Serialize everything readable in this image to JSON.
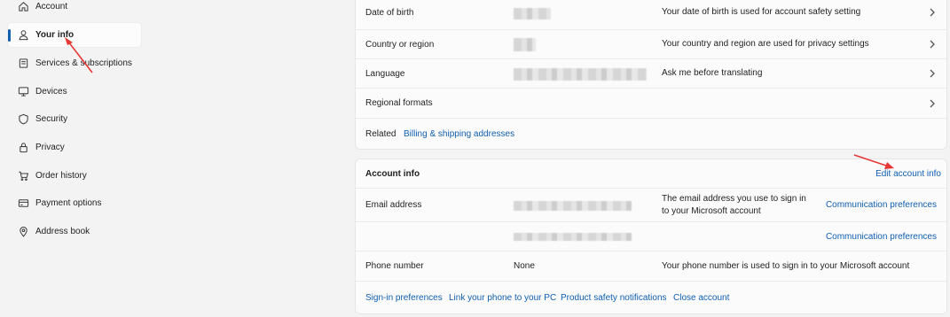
{
  "sidebar": {
    "items": [
      {
        "label": "Account",
        "icon": "home-icon"
      },
      {
        "label": "Your info",
        "icon": "person-icon"
      },
      {
        "label": "Services & subscriptions",
        "icon": "list-icon"
      },
      {
        "label": "Devices",
        "icon": "monitor-icon"
      },
      {
        "label": "Security",
        "icon": "shield-icon"
      },
      {
        "label": "Privacy",
        "icon": "lock-icon"
      },
      {
        "label": "Order history",
        "icon": "cart-icon"
      },
      {
        "label": "Payment options",
        "icon": "card-icon"
      },
      {
        "label": "Address book",
        "icon": "location-icon"
      }
    ],
    "active_index": 1
  },
  "profile_card": {
    "rows": [
      {
        "label": "Date of birth",
        "desc": "Your date of birth is used for account safety setting"
      },
      {
        "label": "Country or region",
        "desc": "Your country and region are used for privacy settings"
      },
      {
        "label": "Language",
        "desc": "Ask me before translating"
      },
      {
        "label": "Regional formats",
        "desc": ""
      }
    ],
    "related_label": "Related",
    "related_link": "Billing & shipping addresses"
  },
  "account_card": {
    "title": "Account info",
    "edit_link": "Edit account info",
    "email_label": "Email address",
    "email_desc_line1": "The email address you use to sign in",
    "email_desc_line2": "to your Microsoft account",
    "comm_pref_1": "Communication preferences",
    "comm_pref_2": "Communication preferences",
    "phone_label": "Phone number",
    "phone_value": "None",
    "phone_desc": "Your phone number is used to sign in to your Microsoft account",
    "footer_links": [
      "Sign-in preferences",
      "Link your phone to your PC",
      "Product safety notifications",
      "Close account"
    ]
  },
  "colors": {
    "accent": "#0f5eb0",
    "annotation_arrow": "#e53935"
  }
}
